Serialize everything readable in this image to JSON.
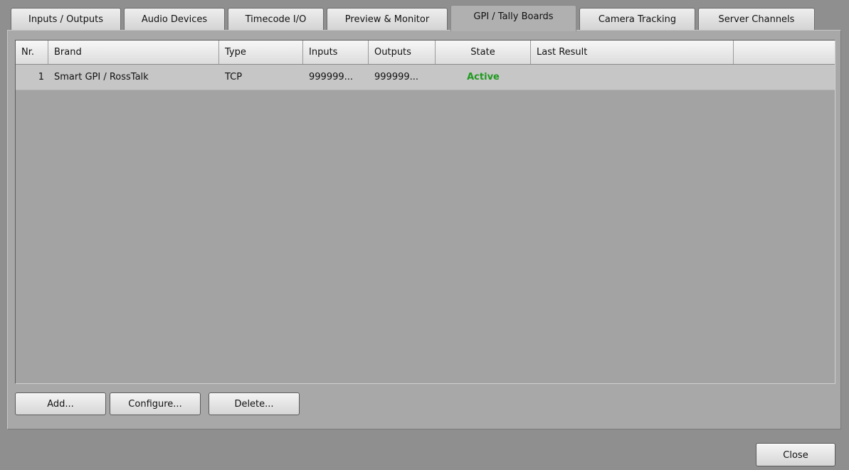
{
  "tabs": [
    {
      "label": "Inputs / Outputs",
      "active": false
    },
    {
      "label": "Audio Devices",
      "active": false
    },
    {
      "label": "Timecode I/O",
      "active": false
    },
    {
      "label": "Preview & Monitor",
      "active": false
    },
    {
      "label": "GPI / Tally Boards",
      "active": true
    },
    {
      "label": "Camera Tracking",
      "active": false
    },
    {
      "label": "Server Channels",
      "active": false
    }
  ],
  "table": {
    "columns": [
      "Nr.",
      "Brand",
      "Type",
      "Inputs",
      "Outputs",
      "State",
      "Last Result"
    ],
    "rows": [
      {
        "nr": "1",
        "brand": "Smart GPI / RossTalk",
        "type": "TCP",
        "inputs": "999999...",
        "outputs": "999999...",
        "state": "Active",
        "last_result": ""
      }
    ]
  },
  "buttons": {
    "add": "Add...",
    "configure": "Configure...",
    "delete": "Delete...",
    "close": "Close"
  },
  "colors": {
    "state_active": "#1f9a1f"
  }
}
